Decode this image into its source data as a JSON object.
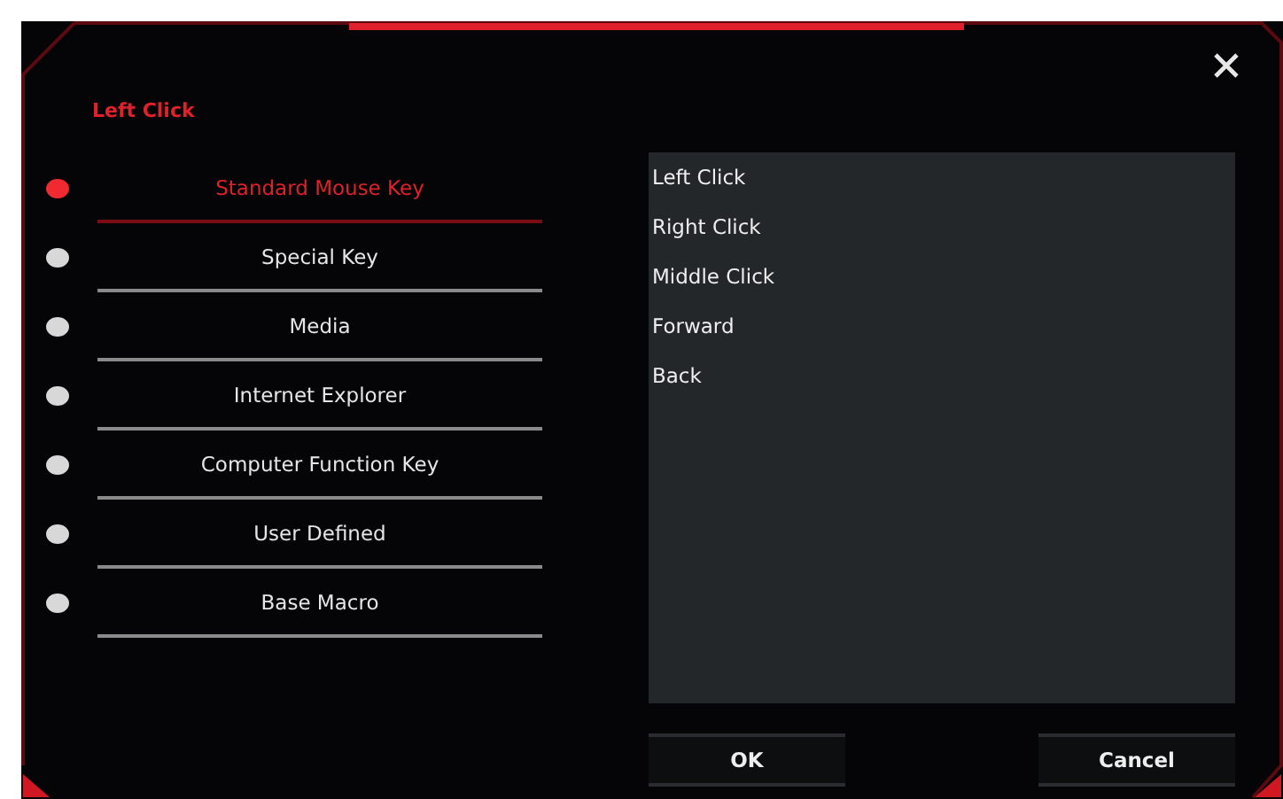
{
  "dialog": {
    "heading": "Left Click",
    "categories": [
      {
        "label": "Standard Mouse Key",
        "selected": true
      },
      {
        "label": "Special Key",
        "selected": false
      },
      {
        "label": "Media",
        "selected": false
      },
      {
        "label": "Internet Explorer",
        "selected": false
      },
      {
        "label": "Computer Function Key",
        "selected": false
      },
      {
        "label": "User Defined",
        "selected": false
      },
      {
        "label": "Base Macro",
        "selected": false
      }
    ],
    "options": [
      "Left Click",
      "Right Click",
      "Middle Click",
      "Forward",
      "Back"
    ],
    "buttons": [
      "OK",
      "Cancel"
    ]
  }
}
